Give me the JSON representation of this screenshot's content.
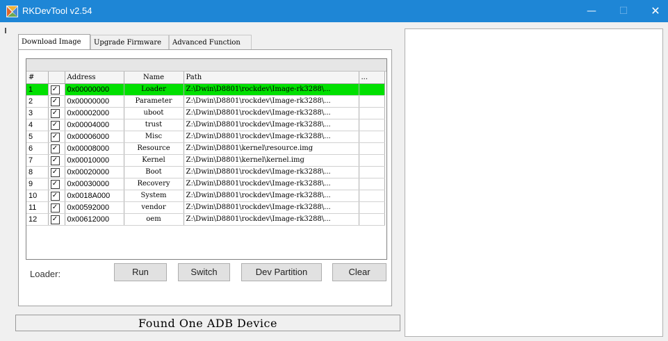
{
  "window": {
    "title": "RKDevTool v2.54",
    "minimize_glyph": "—",
    "maximize_glyph": "☐",
    "close_glyph": "✕",
    "accent": "#1e86d6"
  },
  "tabs": [
    {
      "label": "Download Image",
      "active": true
    },
    {
      "label": "Upgrade Firmware",
      "active": false
    },
    {
      "label": "Advanced Function",
      "active": false
    }
  ],
  "table": {
    "headers": {
      "num": "#",
      "check": "",
      "address": "Address",
      "name": "Name",
      "path": "Path",
      "more": "..."
    },
    "selected_color": "#00e000",
    "rows": [
      {
        "num": "1",
        "checked": "✓",
        "address": "0x00000000",
        "name": "Loader",
        "path": "Z:\\Dwin\\D8801\\rockdev\\Image-rk3288\\..."
      },
      {
        "num": "2",
        "checked": "✓",
        "address": "0x00000000",
        "name": "Parameter",
        "path": "Z:\\Dwin\\D8801\\rockdev\\Image-rk3288\\..."
      },
      {
        "num": "3",
        "checked": "✓",
        "address": "0x00002000",
        "name": "uboot",
        "path": "Z:\\Dwin\\D8801\\rockdev\\Image-rk3288\\..."
      },
      {
        "num": "4",
        "checked": "✓",
        "address": "0x00004000",
        "name": "trust",
        "path": "Z:\\Dwin\\D8801\\rockdev\\Image-rk3288\\..."
      },
      {
        "num": "5",
        "checked": "✓",
        "address": "0x00006000",
        "name": "Misc",
        "path": "Z:\\Dwin\\D8801\\rockdev\\Image-rk3288\\..."
      },
      {
        "num": "6",
        "checked": "✓",
        "address": "0x00008000",
        "name": "Resource",
        "path": "Z:\\Dwin\\D8801\\kernel\\resource.img"
      },
      {
        "num": "7",
        "checked": "✓",
        "address": "0x00010000",
        "name": "Kernel",
        "path": "Z:\\Dwin\\D8801\\kernel\\kernel.img"
      },
      {
        "num": "8",
        "checked": "✓",
        "address": "0x00020000",
        "name": "Boot",
        "path": "Z:\\Dwin\\D8801\\rockdev\\Image-rk3288\\..."
      },
      {
        "num": "9",
        "checked": "✓",
        "address": "0x00030000",
        "name": "Recovery",
        "path": "Z:\\Dwin\\D8801\\rockdev\\Image-rk3288\\..."
      },
      {
        "num": "10",
        "checked": "✓",
        "address": "0x0018A000",
        "name": "System",
        "path": "Z:\\Dwin\\D8801\\rockdev\\Image-rk3288\\..."
      },
      {
        "num": "11",
        "checked": "✓",
        "address": "0x00592000",
        "name": "vendor",
        "path": "Z:\\Dwin\\D8801\\rockdev\\Image-rk3288\\..."
      },
      {
        "num": "12",
        "checked": "✓",
        "address": "0x00612000",
        "name": "oem",
        "path": "Z:\\Dwin\\D8801\\rockdev\\Image-rk3288\\..."
      }
    ]
  },
  "loader_label": "Loader:",
  "buttons": {
    "run": "Run",
    "switch": "Switch",
    "dev_partition": "Dev Partition",
    "clear": "Clear"
  },
  "status": "Found One ADB Device",
  "log": ""
}
